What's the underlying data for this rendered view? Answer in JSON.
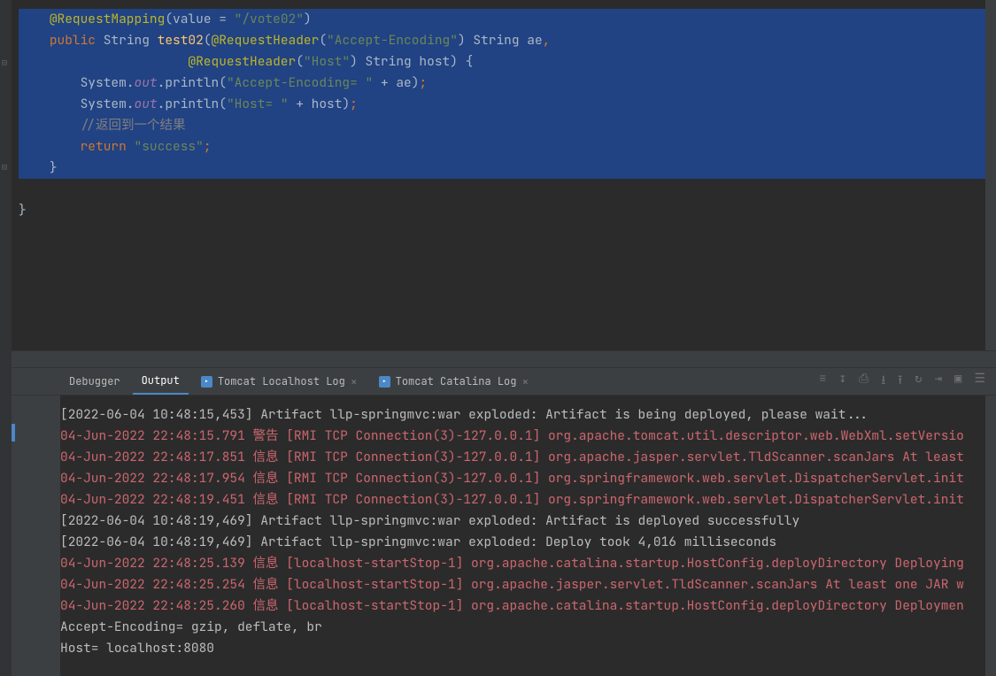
{
  "code": {
    "l1_ann": "@RequestMapping",
    "l1_parenopen": "(",
    "l1_value": "value",
    "l1_eq": " = ",
    "l1_str": "\"/vote02\"",
    "l1_close": ")",
    "l2_kw": "public ",
    "l2_type": "String ",
    "l2_fn": "test02",
    "l2_open": "(",
    "l2_ann": "@RequestHeader",
    "l2_ann_open": "(",
    "l2_str": "\"Accept-Encoding\"",
    "l2_ann_close": ") ",
    "l2_arg": "String ae",
    "l2_comma": ",",
    "l3_ann": "@RequestHeader",
    "l3_ann_open": "(",
    "l3_str": "\"Host\"",
    "l3_ann_close": ") ",
    "l3_arg": "String host) {",
    "l4_sys": "System.",
    "l4_out": "out",
    "l4_print": ".println(",
    "l4_str": "\"Accept-Encoding= \"",
    "l4_plus": " + ae)",
    "l4_semi": ";",
    "l5_sys": "System.",
    "l5_out": "out",
    "l5_print": ".println(",
    "l5_str": "\"Host= \"",
    "l5_plus": " + host)",
    "l5_semi": ";",
    "l6_comment": "//返回到一个结果",
    "l7_ret": "return ",
    "l7_str": "\"success\"",
    "l7_semi": ";",
    "l8_brace": "}",
    "l9_brace": "}"
  },
  "tabs": {
    "t0": "Debugger",
    "t1": "Output",
    "t2": "Tomcat Localhost Log",
    "t3": "Tomcat Catalina Log"
  },
  "log": {
    "r0": "[2022-06-04 10:48:15,453] Artifact llp-springmvc:war exploded: Artifact is being deployed, please wait...",
    "r1": "04-Jun-2022 22:48:15.791 警告 [RMI TCP Connection(3)-127.0.0.1] org.apache.tomcat.util.descriptor.web.WebXml.setVersio",
    "r2": "04-Jun-2022 22:48:17.851 信息 [RMI TCP Connection(3)-127.0.0.1] org.apache.jasper.servlet.TldScanner.scanJars At least",
    "r3": "04-Jun-2022 22:48:17.954 信息 [RMI TCP Connection(3)-127.0.0.1] org.springframework.web.servlet.DispatcherServlet.init",
    "r4": "04-Jun-2022 22:48:19.451 信息 [RMI TCP Connection(3)-127.0.0.1] org.springframework.web.servlet.DispatcherServlet.init",
    "r5": "[2022-06-04 10:48:19,469] Artifact llp-springmvc:war exploded: Artifact is deployed successfully",
    "r6": "[2022-06-04 10:48:19,469] Artifact llp-springmvc:war exploded: Deploy took 4,016 milliseconds",
    "r7": "04-Jun-2022 22:48:25.139 信息 [localhost-startStop-1] org.apache.catalina.startup.HostConfig.deployDirectory Deploying",
    "r8": "04-Jun-2022 22:48:25.254 信息 [localhost-startStop-1] org.apache.jasper.servlet.TldScanner.scanJars At least one JAR w",
    "r9": "04-Jun-2022 22:48:25.260 信息 [localhost-startStop-1] org.apache.catalina.startup.HostConfig.deployDirectory Deploymen",
    "r10": "Accept-Encoding= gzip, deflate, br",
    "r11": "Host= localhost:8080"
  }
}
